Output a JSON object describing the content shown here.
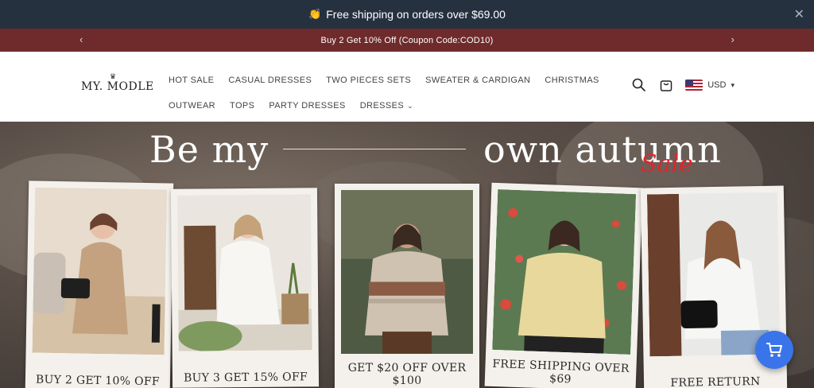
{
  "announcement": {
    "emoji": "👏",
    "text": "Free shipping on orders over $69.00",
    "close": "✕"
  },
  "promo": {
    "text": "Buy 2 Get 10% Off (Coupon Code:COD10)",
    "prev": "‹",
    "next": "›"
  },
  "header": {
    "logo": "MY. MODLE",
    "nav_row1": [
      "HOT SALE",
      "CASUAL DRESSES",
      "TWO PIECES SETS",
      "SWEATER & CARDIGAN",
      "CHRISTMAS"
    ],
    "nav_row2": [
      "OUTWEAR",
      "TOPS",
      "PARTY DRESSES",
      "DRESSES"
    ],
    "currency": "USD"
  },
  "hero": {
    "title_left": "Be my",
    "title_right": "own autumn",
    "sale": "Sale",
    "cards": [
      {
        "caption": "BUY 2 GET 10% OFF"
      },
      {
        "caption": "BUY 3 GET 15% OFF"
      },
      {
        "caption": "GET $20 OFF OVER $100"
      },
      {
        "caption": "FREE SHIPPING OVER $69"
      },
      {
        "caption": "FREE RETURN"
      }
    ]
  },
  "colors": {
    "topbar": "#263140",
    "promobar": "#6f2b2b",
    "accent": "#3a74ea",
    "sale": "#e0262b"
  }
}
